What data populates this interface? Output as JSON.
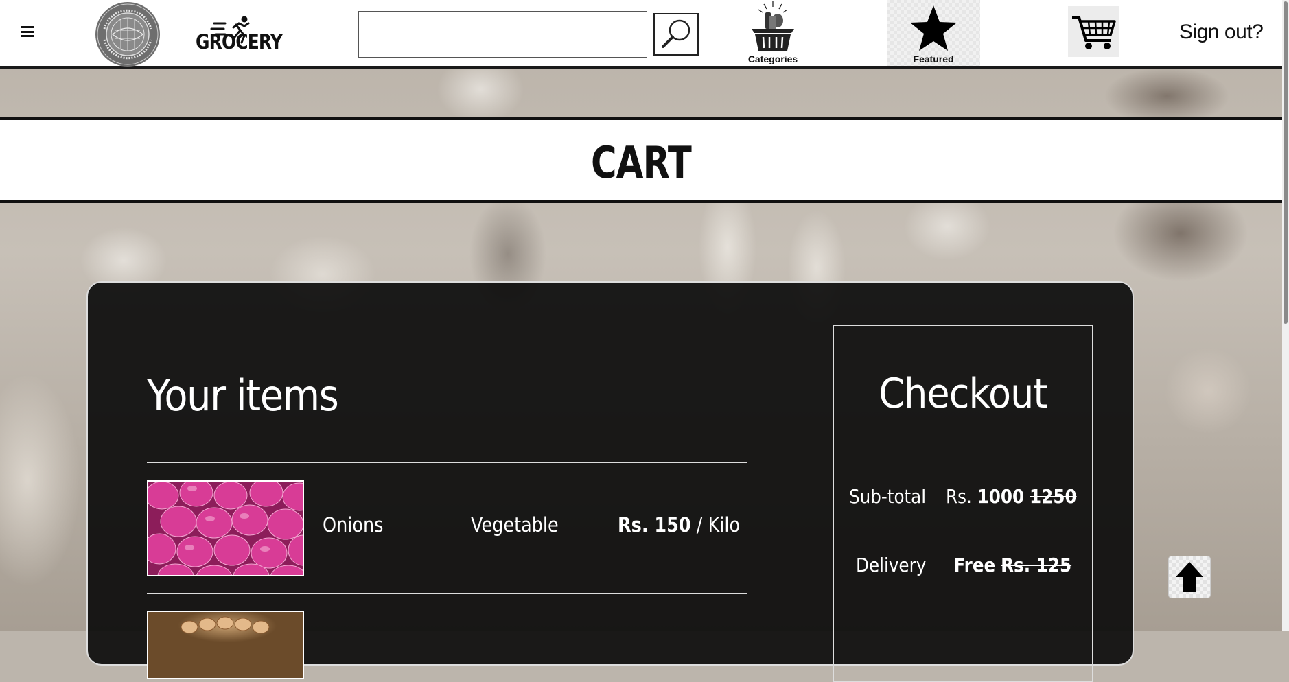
{
  "header": {
    "menu_icon": "hamburger-menu-icon",
    "logo_icon": "university-seal-logo",
    "brand_name": "GROCERY",
    "brand_icon": "running-man-icon",
    "search": {
      "value": "",
      "placeholder": "",
      "button_icon": "magnifier-icon"
    },
    "nav": [
      {
        "label": "Categories",
        "icon": "grocery-basket-icon"
      },
      {
        "label": "Featured",
        "icon": "star-icon"
      }
    ],
    "cart_icon": "shopping-cart-icon",
    "signout_label": "Sign out?"
  },
  "page": {
    "title": "CART"
  },
  "items_section": {
    "heading": "Your items",
    "items": [
      {
        "name": "Onions",
        "category": "Vegetable",
        "price_prefix": "Rs. 150",
        "price_unit": " / Kilo",
        "image": "onions-photo"
      },
      {
        "image": "eggs-basket-photo"
      }
    ]
  },
  "checkout": {
    "title": "Checkout",
    "subtotal_label": "Sub-total",
    "subtotal_prefix": "Rs. ",
    "subtotal_value": "1000",
    "subtotal_old": "1250",
    "delivery_label": "Delivery",
    "delivery_value": "Free",
    "delivery_old": "Rs. 125"
  },
  "back_to_top_icon": "up-arrow-icon",
  "colors": {
    "panel_bg": "#080808",
    "header_bg": "#ffffff",
    "text_dark": "#111111",
    "text_light": "#ffffff"
  }
}
